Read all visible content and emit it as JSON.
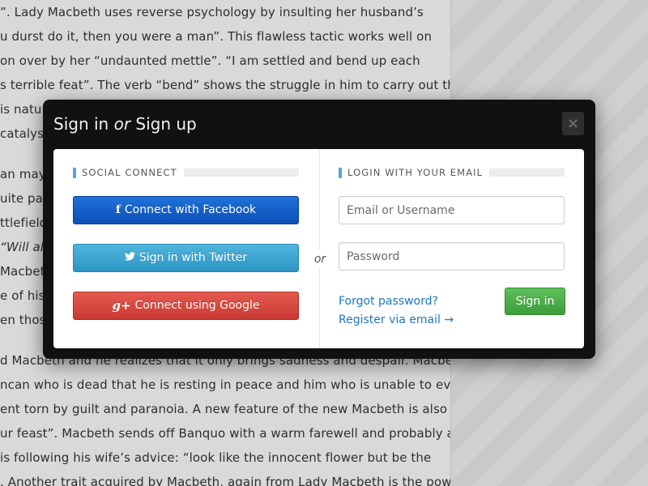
{
  "background_article": {
    "lines": [
      {
        "t": "”. Lady Macbeth uses reverse psychology by insulting her husband’s"
      },
      {
        "t": "u durst do it, then you were a man”. This flawless tactic works well on"
      },
      {
        "t": "on over by her “undaunted mettle”. “I am settled and bend up each"
      },
      {
        "t": "s terrible feat”. The verb “bend” shows the struggle in him to carry out the"
      },
      {
        "t": "is natur"
      },
      {
        "t": "catalyst"
      },
      {
        "t": "an may"
      },
      {
        "t": "uite para"
      },
      {
        "t": "ttlefield;"
      },
      {
        "t": " “Will al"
      },
      {
        "t": " Macbet"
      },
      {
        "t": "e of his"
      },
      {
        "t": "en thos"
      },
      {
        "t": "d Macbeth and he realizes that it only brings sadness and despair. Macbeth"
      },
      {
        "t": "ncan who is dead that he is resting in peace and him who is unable to even"
      },
      {
        "t": "ent torn by guilt and paranoia. A new feature of the new Macbeth is also"
      },
      {
        "t": "ur feast”. Macbeth sends off Banquo with a warm farewell and probably a"
      },
      {
        "t": " is following his wife’s advice: “look like the innocent flower but be the"
      },
      {
        "t": ". Another trait acquired by Macbeth, again from Lady Macbeth is the power"
      }
    ]
  },
  "modal": {
    "title_part1": "Sign in ",
    "title_or": "or",
    "title_part2": " Sign up",
    "close_label": "×"
  },
  "social": {
    "heading": "Social Connect",
    "facebook": {
      "icon": "f",
      "label": "Connect with Facebook"
    },
    "twitter": {
      "icon": "🐦",
      "label": "Sign in with Twitter"
    },
    "google": {
      "icon": "g+",
      "label": "Connect using Google"
    }
  },
  "divider_label": "or",
  "email_login": {
    "heading": "Login with your email",
    "email_placeholder": "Email or Username",
    "password_placeholder": "Password",
    "forgot_link": "Forgot password?",
    "register_link": "Register via email →",
    "signin_label": "Sign in"
  },
  "colors": {
    "facebook": "#1760cb",
    "twitter": "#3da7d1",
    "google": "#d7473f",
    "signin": "#4caf48",
    "link": "#1d76bd",
    "accent_mark": "#55a6e0"
  }
}
